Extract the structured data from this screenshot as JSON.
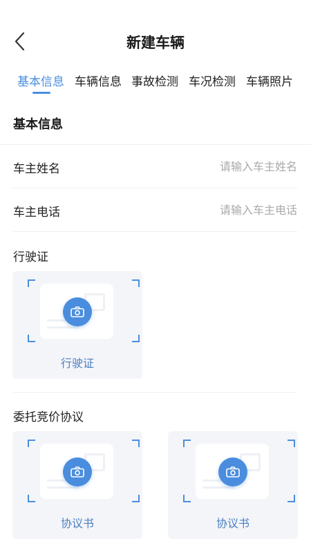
{
  "header": {
    "title": "新建车辆"
  },
  "tabs": [
    {
      "label": "基本信息",
      "active": true
    },
    {
      "label": "车辆信息",
      "active": false
    },
    {
      "label": "事故检测",
      "active": false
    },
    {
      "label": "车况检测",
      "active": false
    },
    {
      "label": "车辆照片",
      "active": false
    }
  ],
  "section": {
    "title": "基本信息"
  },
  "form": {
    "owner_name": {
      "label": "车主姓名",
      "placeholder": "请输入车主姓名",
      "value": ""
    },
    "owner_phone": {
      "label": "车主电话",
      "placeholder": "请输入车主电话",
      "value": ""
    }
  },
  "license": {
    "label": "行驶证",
    "cards": [
      {
        "caption": "行驶证",
        "icon": "camera-icon"
      }
    ]
  },
  "agreement": {
    "label": "委托竞价协议",
    "cards": [
      {
        "caption": "协议书",
        "icon": "camera-icon"
      },
      {
        "caption": "协议书",
        "icon": "camera-icon"
      }
    ]
  },
  "colors": {
    "accent": "#4a8dde",
    "card_bg": "#f4f5f9",
    "placeholder": "#a9a9a9"
  }
}
